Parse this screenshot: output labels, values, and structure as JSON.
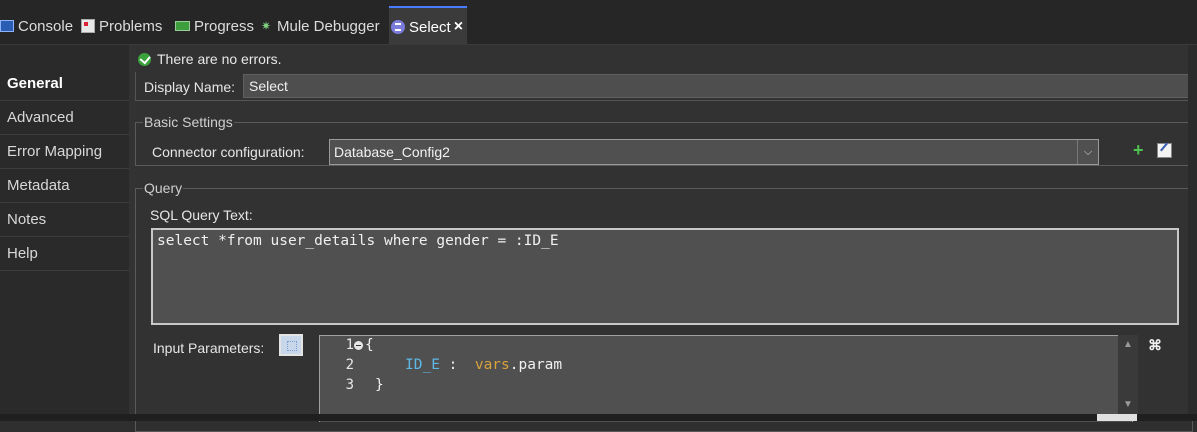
{
  "tabs": [
    {
      "label": "Console",
      "icon": "console-icon"
    },
    {
      "label": "Problems",
      "icon": "problems-icon"
    },
    {
      "label": "Progress",
      "icon": "progress-icon"
    },
    {
      "label": "Mule Debugger",
      "icon": "debugger-icon"
    },
    {
      "label": "Select",
      "icon": "database-icon",
      "active": true
    }
  ],
  "nav": [
    "General",
    "Advanced",
    "Error Mapping",
    "Metadata",
    "Notes",
    "Help"
  ],
  "nav_selected": "General",
  "status": "There are no errors.",
  "display_name": {
    "label": "Display Name:",
    "value": "Select"
  },
  "basic_settings": {
    "legend": "Basic Settings",
    "connector_label": "Connector configuration:",
    "connector_value": "Database_Config2"
  },
  "query": {
    "legend": "Query",
    "sql_label": "SQL Query Text:",
    "sql_text": "select *from user_details where gender = :ID_E",
    "input_params_label": "Input Parameters:",
    "line_numbers": [
      "1",
      "2",
      "3"
    ],
    "code": {
      "line1": "{",
      "line2_key": "ID_E",
      "line2_sep": " :  ",
      "line2_kw": "vars",
      "line2_rest": ".param",
      "line3": "}"
    }
  },
  "colors": {
    "accent": "#4a7cff",
    "ok": "#3aa23a",
    "key": "#5fb8e6",
    "keyword": "#d9a23b"
  }
}
